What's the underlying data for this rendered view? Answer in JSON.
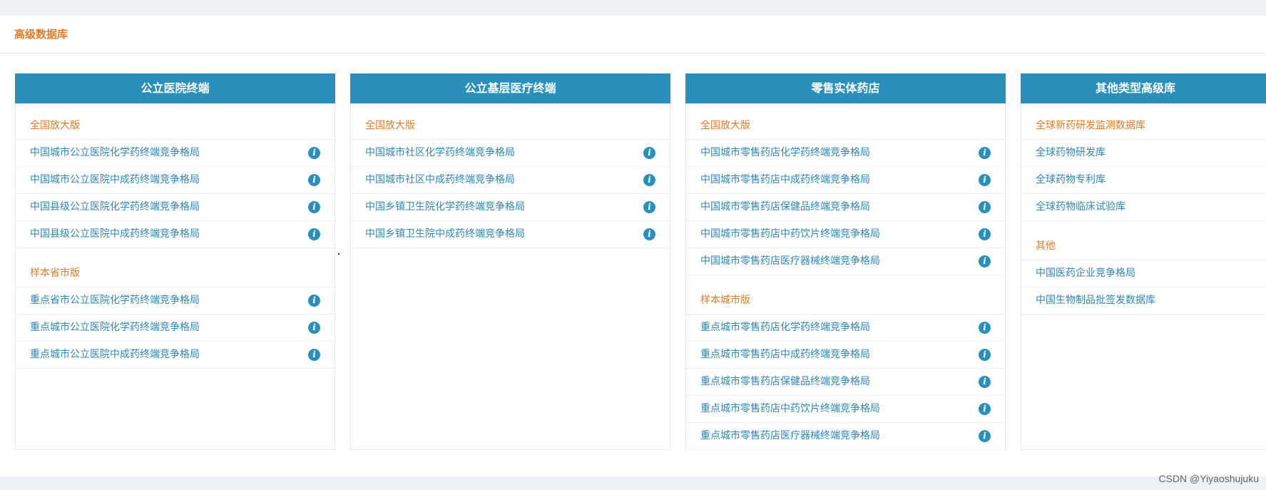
{
  "panel": {
    "title": "高级数据库"
  },
  "columns": [
    {
      "title": "公立医院终端",
      "groups": [
        {
          "title": "全国放大版",
          "items": [
            "中国城市公立医院化学药终端竞争格局",
            "中国城市公立医院中成药终端竞争格局",
            "中国县级公立医院化学药终端竞争格局",
            "中国县级公立医院中成药终端竞争格局"
          ]
        },
        {
          "title": "样本省市版",
          "items": [
            "重点省市公立医院化学药终端竞争格局",
            "重点城市公立医院化学药终端竞争格局",
            "重点城市公立医院中成药终端竞争格局"
          ]
        }
      ]
    },
    {
      "title": "公立基层医疗终端",
      "groups": [
        {
          "title": "全国放大版",
          "items": [
            "中国城市社区化学药终端竞争格局",
            "中国城市社区中成药终端竞争格局",
            "中国乡镇卫生院化学药终端竞争格局",
            "中国乡镇卫生院中成药终端竞争格局"
          ]
        }
      ]
    },
    {
      "title": "零售实体药店",
      "groups": [
        {
          "title": "全国放大版",
          "items": [
            "中国城市零售药店化学药终端竞争格局",
            "中国城市零售药店中成药终端竞争格局",
            "中国城市零售药店保健品终端竞争格局",
            "中国城市零售药店中药饮片终端竞争格局",
            "中国城市零售药店医疗器械终端竞争格局"
          ]
        },
        {
          "title": "样本城市版",
          "items": [
            "重点城市零售药店化学药终端竞争格局",
            "重点城市零售药店中成药终端竞争格局",
            "重点城市零售药店保健品终端竞争格局",
            "重点城市零售药店中药饮片终端竞争格局",
            "重点城市零售药店医疗器械终端竞争格局"
          ]
        }
      ]
    },
    {
      "title": "其他类型高级库",
      "groups": [
        {
          "title": "全球新药研发监测数据库",
          "title_clickable": true,
          "items": [
            "全球药物研发库",
            "全球药物专利库",
            "全球药物临床试验库"
          ],
          "no_info": true
        },
        {
          "title": "其他",
          "items": [
            "中国医药企业竞争格局",
            "中国生物制品批签发数据库"
          ],
          "no_info": true
        }
      ]
    }
  ],
  "icons": {
    "info": "info-icon",
    "info_glyph": "i"
  },
  "colors": {
    "accent_blue": "#2b8fbb",
    "link_blue": "#2f86b3",
    "group_orange": "#e07b2a"
  },
  "watermark": "CSDN @Yiyaoshujuku"
}
